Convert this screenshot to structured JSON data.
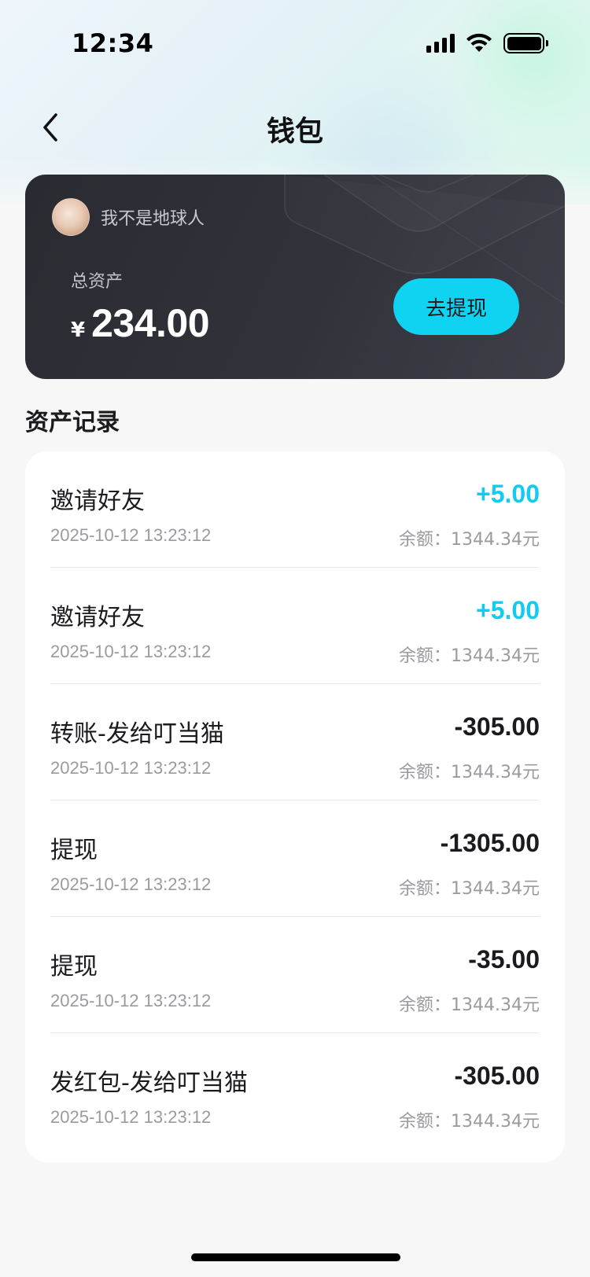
{
  "status_bar": {
    "time": "12:34",
    "icons": [
      "signal-icon",
      "wifi-icon",
      "battery-icon"
    ]
  },
  "nav": {
    "title": "钱包",
    "back_icon": "chevron-left-icon"
  },
  "wallet_card": {
    "user_name": "我不是地球人",
    "asset_label": "总资产",
    "currency_symbol": "¥",
    "asset_value": "234.00",
    "withdraw_label": "去提现"
  },
  "records": {
    "section_title": "资产记录",
    "items": [
      {
        "title": "邀请好友",
        "time": "2025-10-12  13:23:12",
        "amount": "+5.00",
        "balance": "余额：1344.34元",
        "positive": true
      },
      {
        "title": "邀请好友",
        "time": "2025-10-12  13:23:12",
        "amount": "+5.00",
        "balance": "余额：1344.34元",
        "positive": true
      },
      {
        "title": "转账-发给叮当猫",
        "time": "2025-10-12  13:23:12",
        "amount": "-305.00",
        "balance": "余额：1344.34元",
        "positive": false
      },
      {
        "title": "提现",
        "time": "2025-10-12  13:23:12",
        "amount": "-1305.00",
        "balance": "余额：1344.34元",
        "positive": false
      },
      {
        "title": "提现",
        "time": "2025-10-12  13:23:12",
        "amount": "-35.00",
        "balance": "余额：1344.34元",
        "positive": false
      },
      {
        "title": "发红包-发给叮当猫",
        "time": "2025-10-12  13:23:12",
        "amount": "-305.00",
        "balance": "余额：1344.34元",
        "positive": false
      }
    ]
  },
  "colors": {
    "accent": "#0fd3f0",
    "positive_amount": "#12cbee",
    "card_background": "#2f2f37"
  }
}
